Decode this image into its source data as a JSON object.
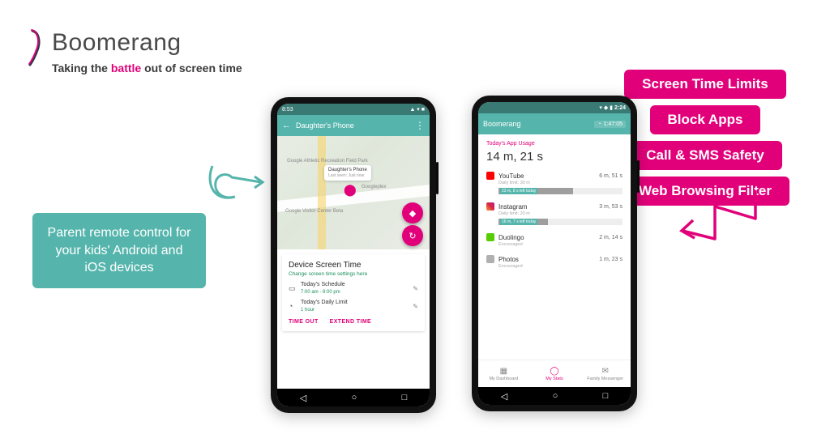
{
  "brand": {
    "name": "Boomerang",
    "tagline_before": "Taking the ",
    "tagline_accent": "battle",
    "tagline_after": " out of screen time"
  },
  "callout": "Parent remote control for your kids' Android and iOS devices",
  "features": [
    "Screen Time Limits",
    "Block Apps",
    "Call & SMS Safety",
    "Web Browsing Filter"
  ],
  "phone1": {
    "status_time": "8:53",
    "appbar_title": "Daughter's Phone",
    "map_label1": "Google Athletic Recreation Field Park",
    "map_label2": "Google Visitor Center Beta",
    "map_label3": "Googleplex",
    "tooltip_title": "Daughter's Phone",
    "tooltip_sub": "Last seen: Just now",
    "card_title": "Device Screen Time",
    "card_link": "Change screen time settings here",
    "row1_label": "Today's Schedule",
    "row1_value": "7:00 am - 8:00 pm",
    "row2_label": "Today's Daily Limit",
    "row2_value": "1 hour",
    "action1": "TIME OUT",
    "action2": "EXTEND TIME"
  },
  "phone2": {
    "status_time": "2:24",
    "appbar_title": "Boomerang",
    "timer": "1:47:05",
    "usage_head": "Today's App Usage",
    "usage_total": "14 m, 21 s",
    "apps": [
      {
        "name": "YouTube",
        "time": "6 m, 51 s",
        "sub": "Daily limit: 30 m",
        "bar_label": "23 m, 8 s left today",
        "bar_pct": 60
      },
      {
        "name": "Instagram",
        "time": "3 m, 53 s",
        "sub": "Daily limit: 20 m",
        "bar_label": "16 m, 7 s left today",
        "bar_pct": 40
      },
      {
        "name": "Duolingo",
        "time": "2 m, 14 s",
        "sub": "Encouraged"
      },
      {
        "name": "Photos",
        "time": "1 m, 23 s",
        "sub": "Encouraged"
      }
    ],
    "tabs": [
      {
        "label": "My Dashboard",
        "icon": "▦"
      },
      {
        "label": "My Stats",
        "icon": "◯",
        "active": true
      },
      {
        "label": "Family Messenger",
        "icon": "✉"
      }
    ]
  }
}
